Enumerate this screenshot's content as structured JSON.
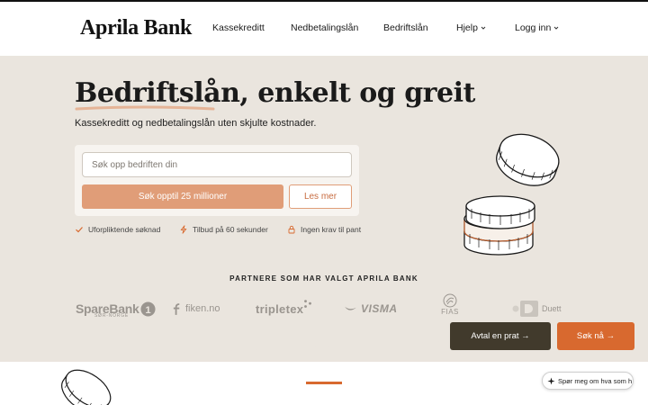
{
  "header": {
    "logo": "Aprila Bank",
    "nav": [
      {
        "label": "Kassekreditt",
        "dropdown": false
      },
      {
        "label": "Nedbetalingslån",
        "dropdown": false
      },
      {
        "label": "Bedriftslån",
        "dropdown": false
      },
      {
        "label": "Hjelp",
        "dropdown": true
      },
      {
        "label": "Logg inn",
        "dropdown": true
      }
    ]
  },
  "hero": {
    "title": "Bedriftslån, enkelt og greit",
    "subtitle": "Kassekreditt og nedbetalingslån uten skjulte kostnader.",
    "search": {
      "placeholder": "Søk opp bedriften din",
      "value": ""
    },
    "primary_button": "Søk opptil 25 millioner",
    "secondary_button": "Les mer",
    "features": [
      {
        "icon": "check-icon",
        "label": "Uforpliktende søknad"
      },
      {
        "icon": "lightning-icon",
        "label": "Tilbud på 60 sekunder"
      },
      {
        "icon": "lock-icon",
        "label": "Ingen krav til pant"
      }
    ]
  },
  "partners": {
    "title": "PARTNERE SOM HAR VALGT APRILA BANK",
    "logos": {
      "sparebank": {
        "name": "SpareBank",
        "sub": "SØR-NORGE"
      },
      "fiken": {
        "name": "fiken.no"
      },
      "tripletex": {
        "name": "tripletex"
      },
      "visma": {
        "name": "VISMA"
      },
      "fias": {
        "name": "FIAS"
      },
      "duett": {
        "name": "Duett"
      }
    }
  },
  "cta": {
    "avtal": "Avtal en prat →",
    "sok": "Søk nå →"
  },
  "chat": {
    "label": "Spør meg om hva som h"
  },
  "colors": {
    "hero_bg": "#eae5de",
    "accent_light": "#e09d78",
    "accent_dark": "#d8692f",
    "cta_dark": "#413a2c"
  }
}
